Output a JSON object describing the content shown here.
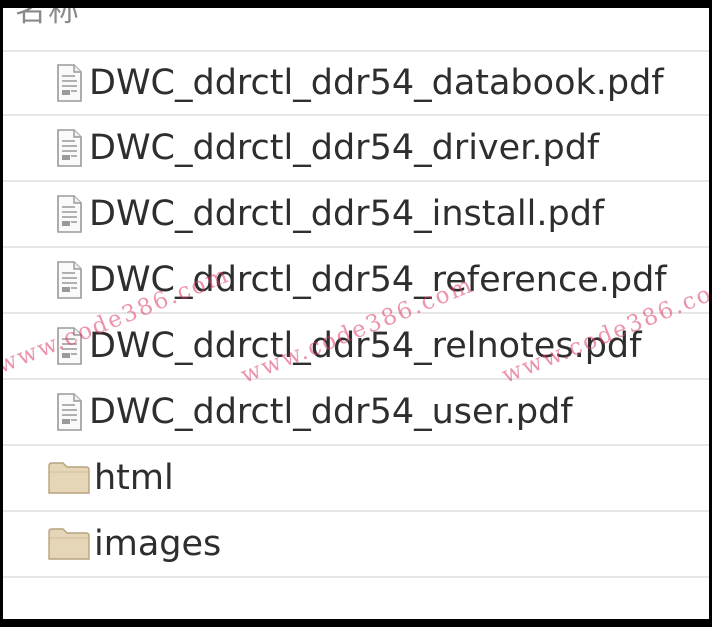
{
  "header": {
    "column_name": "名称"
  },
  "files": [
    {
      "name": "DWC_ddrctl_ddr54_databook.pdf",
      "icon": "pdf-file-icon",
      "type": "file"
    },
    {
      "name": "DWC_ddrctl_ddr54_driver.pdf",
      "icon": "pdf-file-icon",
      "type": "file"
    },
    {
      "name": "DWC_ddrctl_ddr54_install.pdf",
      "icon": "pdf-file-icon",
      "type": "file"
    },
    {
      "name": "DWC_ddrctl_ddr54_reference.pdf",
      "icon": "pdf-file-icon",
      "type": "file"
    },
    {
      "name": "DWC_ddrctl_ddr54_relnotes.pdf",
      "icon": "pdf-file-icon",
      "type": "file"
    },
    {
      "name": "DWC_ddrctl_ddr54_user.pdf",
      "icon": "pdf-file-icon",
      "type": "file"
    },
    {
      "name": "html",
      "icon": "folder-icon",
      "type": "folder"
    },
    {
      "name": "images",
      "icon": "folder-icon",
      "type": "folder"
    }
  ],
  "watermark": {
    "text": "www.code386.com"
  },
  "colors": {
    "folder_fill": "#e6d6b8",
    "folder_stroke": "#b8a27e",
    "file_stroke": "#9a9a9a",
    "watermark": "#dc3c64"
  }
}
